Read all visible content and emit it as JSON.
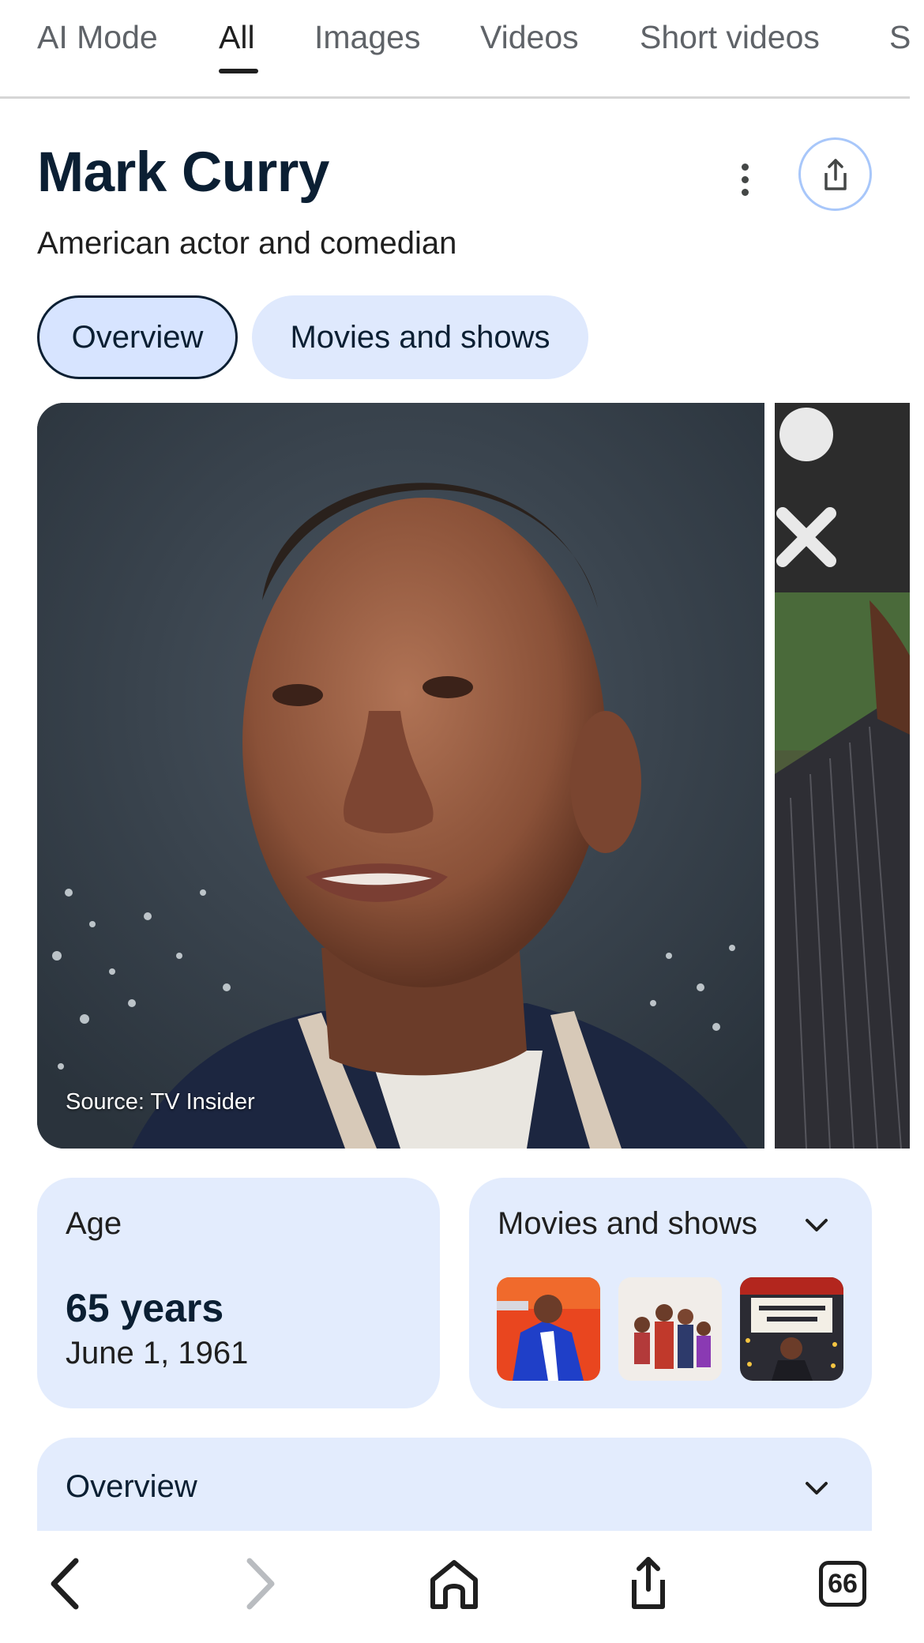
{
  "tabs": [
    {
      "label": "AI Mode"
    },
    {
      "label": "All"
    },
    {
      "label": "Images"
    },
    {
      "label": "Videos"
    },
    {
      "label": "Short videos"
    },
    {
      "label": "S"
    }
  ],
  "header": {
    "title": "Mark Curry",
    "subtitle": "American actor and comedian"
  },
  "chips": [
    {
      "label": "Overview"
    },
    {
      "label": "Movies and shows"
    }
  ],
  "image": {
    "source": "Source: TV Insider"
  },
  "age_card": {
    "label": "Age",
    "value": "65 years",
    "date": "June 1, 1961"
  },
  "movies_card": {
    "label": "Movies and shows"
  },
  "overview_card": {
    "label": "Overview"
  },
  "toolbar": {
    "tabs_count": "66"
  },
  "colors": {
    "accent_outline": "#a8c7fa",
    "card_bg": "#e3ecfd",
    "title": "#0b1f33"
  }
}
